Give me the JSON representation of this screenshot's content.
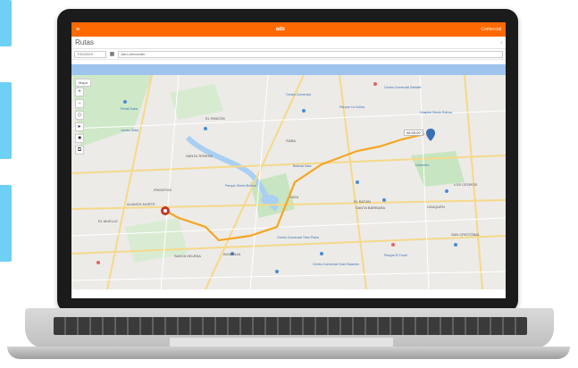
{
  "app": {
    "brand": "adx",
    "top_link": "Comercial",
    "menu_icon": "hamburger-icon",
    "page_title": "Rutas"
  },
  "filters": {
    "date": "7/10/2023",
    "vehicle": "Jairo Alexander"
  },
  "map": {
    "type_label": "Mapa",
    "timestamp": "08:35:00",
    "labels": [
      "EL RINCÓN",
      "SANTA TERESA",
      "ENGATIVÁ",
      "ALAMOS NORTE",
      "EL MUELLE",
      "SANTA HELENA",
      "BONANZA",
      "NIZA",
      "SUBA",
      "EL BATÁN",
      "SANTA BÁRBARA",
      "USAQUÉN",
      "LOS CEDROS",
      "SAN CRISTÓBAL"
    ],
    "pois": [
      "Centro Comercial",
      "Parque La Colina",
      "Bulevar Niza",
      "Centro Comercial Santafé",
      "Portal Suba",
      "Parque Simón Bolívar",
      "Unicentro",
      "Centro Comercial Titán Plaza",
      "Parque El Tunal",
      "Jumbo Suba",
      "Centro Comercial Gran Estación",
      "Hospital Simón Bolívar"
    ]
  },
  "colors": {
    "topbar": "#ff6a00",
    "blue_band": "#9ec4ee",
    "route": "#f4a623",
    "side_tabs": "#6fd0f5"
  }
}
